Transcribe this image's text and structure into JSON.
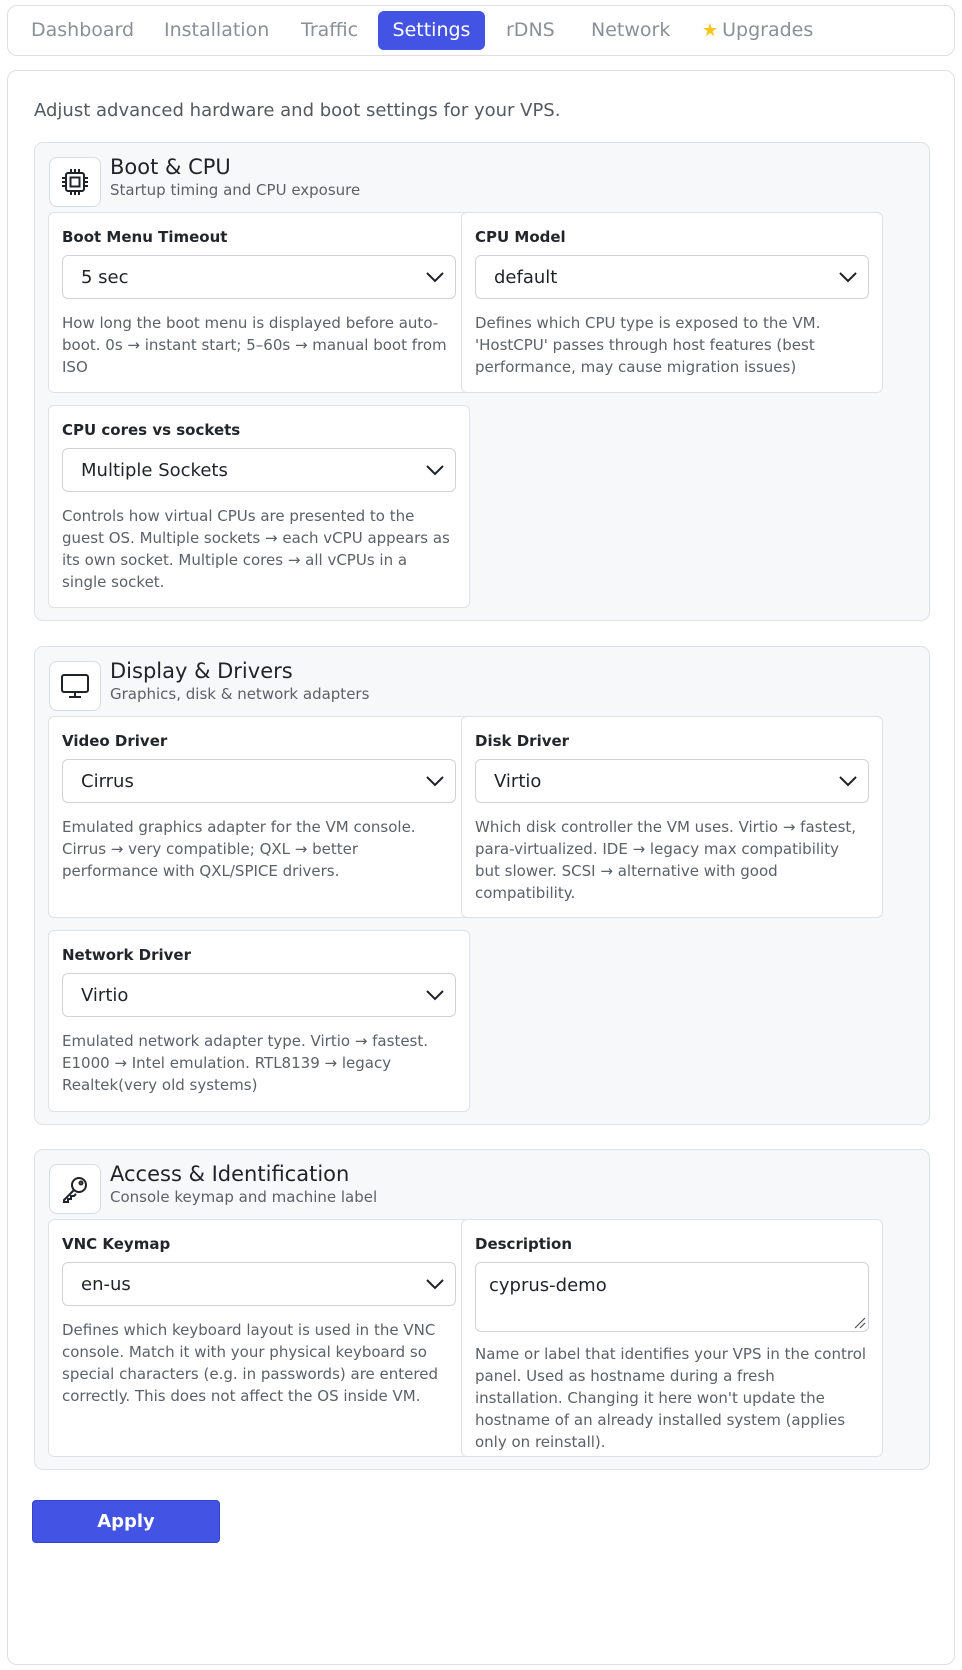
{
  "tabs": [
    {
      "label": "Dashboard"
    },
    {
      "label": "Installation"
    },
    {
      "label": "Traffic"
    },
    {
      "label": "Settings",
      "active": true
    },
    {
      "label": "rDNS"
    },
    {
      "label": "Network"
    },
    {
      "label": "Upgrades",
      "icon": "star-icon"
    }
  ],
  "intro": "Adjust advanced hardware and boot settings for your VPS.",
  "sections": {
    "boot": {
      "icon": "cpu-chip-icon",
      "title": "Boot & CPU",
      "subtitle": "Startup timing and CPU exposure",
      "boot_timeout": {
        "label": "Boot Menu Timeout",
        "value": "5 sec",
        "help": "How long the boot menu is displayed before auto-boot. 0s → instant start; 5–60s → manual boot from ISO"
      },
      "cpu_model": {
        "label": "CPU Model",
        "value": "default",
        "help": "Defines which CPU type is exposed to the VM. 'HostCPU' passes through host features (best performance, may cause migration issues)"
      },
      "cores_sockets": {
        "label": "CPU cores vs sockets",
        "value": "Multiple Sockets",
        "help": "Controls how virtual CPUs are presented to the guest OS. Multiple sockets → each vCPU appears as its own socket. Multiple cores → all vCPUs in a single socket."
      }
    },
    "display": {
      "icon": "monitor-icon",
      "title": "Display & Drivers",
      "subtitle": "Graphics, disk & network adapters",
      "video_driver": {
        "label": "Video Driver",
        "value": "Cirrus",
        "help": "Emulated graphics adapter for the VM console. Cirrus → very compatible; QXL → better performance with QXL/SPICE drivers."
      },
      "disk_driver": {
        "label": "Disk Driver",
        "value": "Virtio",
        "help": "Which disk controller the VM uses. Virtio → fastest, para-virtualized. IDE → legacy max compatibility but slower. SCSI → alternative with good compatibility."
      },
      "network_driver": {
        "label": "Network Driver",
        "value": "Virtio",
        "help": "Emulated network adapter type. Virtio → fastest. E1000 → Intel emulation. RTL8139 → legacy Realtek(very old systems)"
      }
    },
    "access": {
      "icon": "key-icon",
      "title": "Access & Identification",
      "subtitle": "Console keymap and machine label",
      "vnc_keymap": {
        "label": "VNC Keymap",
        "value": "en-us",
        "help": "Defines which keyboard layout is used in the VNC console. Match it with your physical keyboard so special characters (e.g. in passwords) are entered correctly. This does not affect the OS inside VM."
      },
      "description": {
        "label": "Description",
        "value": "cyprus-demo",
        "help": "Name or label that identifies your VPS in the control panel. Used as hostname during a fresh installation. Changing it here won't update the hostname of an already installed system (applies only on reinstall)."
      }
    }
  },
  "apply_label": "Apply",
  "colors": {
    "accent": "#4353e3",
    "star": "#f5c518"
  }
}
